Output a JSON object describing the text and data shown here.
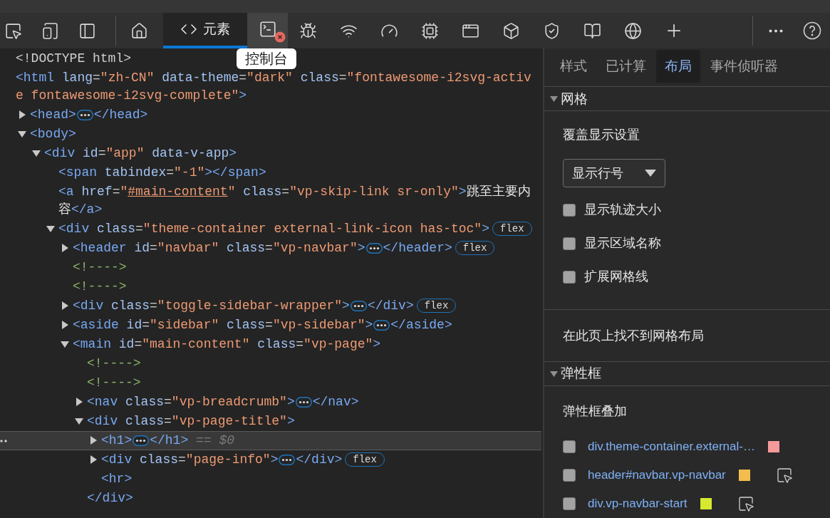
{
  "toolbar": {
    "tools": [
      {
        "kind": "inspect",
        "selected": false
      },
      {
        "kind": "device",
        "selected": false
      },
      {
        "kind": "dock",
        "selected": false
      },
      {
        "kind": "divider"
      },
      {
        "kind": "home",
        "selected": false
      },
      {
        "kind": "elements",
        "label": "元素",
        "selected": true
      },
      {
        "kind": "console",
        "selected": false,
        "hovered": true,
        "error": true,
        "tooltip": "控制台"
      },
      {
        "kind": "sources",
        "selected": false
      },
      {
        "kind": "network",
        "selected": false
      },
      {
        "kind": "performance",
        "selected": false
      },
      {
        "kind": "memory",
        "selected": false
      },
      {
        "kind": "application",
        "selected": false
      },
      {
        "kind": "cube",
        "selected": false
      },
      {
        "kind": "security",
        "selected": false
      },
      {
        "kind": "recorder",
        "selected": false
      },
      {
        "kind": "network-console",
        "selected": false
      },
      {
        "kind": "add",
        "selected": false
      },
      {
        "kind": "spacer"
      },
      {
        "kind": "divider"
      },
      {
        "kind": "more",
        "selected": false
      },
      {
        "kind": "help",
        "selected": false
      }
    ]
  },
  "dom": [
    {
      "tokens": [
        {
          "kind": "doctype",
          "text": "<!DOCTYPE html>"
        }
      ]
    },
    {
      "tokens": [
        {
          "kind": "tag",
          "text": "<html"
        },
        {
          "kind": "attr",
          "text": " lang"
        },
        {
          "kind": "eq",
          "text": "="
        },
        {
          "kind": "value",
          "text": "\"zh-CN\""
        },
        {
          "kind": "attr",
          "text": " data-theme"
        },
        {
          "kind": "eq",
          "text": "="
        },
        {
          "kind": "value",
          "text": "\"dark\""
        },
        {
          "kind": "attr",
          "text": " class"
        },
        {
          "kind": "eq",
          "text": "="
        },
        {
          "kind": "value",
          "text": "\"fontawesome-i2svg-active fontawesome-i2svg-complete\""
        },
        {
          "kind": "tag",
          "text": ">"
        }
      ],
      "children": [
        {
          "expanded": false,
          "tokens": [
            {
              "kind": "tag",
              "text": "<head>"
            },
            {
              "kind": "ellipsis"
            },
            {
              "kind": "tag",
              "text": "</head>"
            }
          ]
        },
        {
          "expanded": true,
          "tokens": [
            {
              "kind": "tag",
              "text": "<body>"
            }
          ],
          "children": [
            {
              "expanded": true,
              "tokens": [
                {
                  "kind": "tag",
                  "text": "<div"
                },
                {
                  "kind": "attr",
                  "text": " id"
                },
                {
                  "kind": "eq",
                  "text": "="
                },
                {
                  "kind": "value",
                  "text": "\"app\""
                },
                {
                  "kind": "attr",
                  "text": " data-v-app"
                },
                {
                  "kind": "tag",
                  "text": ">"
                }
              ],
              "children": [
                {
                  "tokens": [
                    {
                      "kind": "tag",
                      "text": "<span"
                    },
                    {
                      "kind": "attr",
                      "text": " tabindex"
                    },
                    {
                      "kind": "eq",
                      "text": "="
                    },
                    {
                      "kind": "value",
                      "text": "\"-1\""
                    },
                    {
                      "kind": "tag",
                      "text": "></span>"
                    }
                  ]
                },
                {
                  "tokens": [
                    {
                      "kind": "tag",
                      "text": "<a"
                    },
                    {
                      "kind": "attr",
                      "text": " href"
                    },
                    {
                      "kind": "eq",
                      "text": "="
                    },
                    {
                      "kind": "value",
                      "text": "\""
                    },
                    {
                      "kind": "link",
                      "text": "#main-content"
                    },
                    {
                      "kind": "value",
                      "text": "\""
                    },
                    {
                      "kind": "attr",
                      "text": " class"
                    },
                    {
                      "kind": "eq",
                      "text": "="
                    },
                    {
                      "kind": "value",
                      "text": "\"vp-skip-link sr-only\""
                    },
                    {
                      "kind": "tag",
                      "text": ">"
                    },
                    {
                      "kind": "text",
                      "text": "跳至主要内容"
                    },
                    {
                      "kind": "tag",
                      "text": "</a>"
                    }
                  ]
                },
                {
                  "expanded": true,
                  "tokens": [
                    {
                      "kind": "tag",
                      "text": "<div"
                    },
                    {
                      "kind": "attr",
                      "text": " class"
                    },
                    {
                      "kind": "eq",
                      "text": "="
                    },
                    {
                      "kind": "value",
                      "text": "\"theme-container external-link-icon has-toc\""
                    },
                    {
                      "kind": "tag",
                      "text": ">"
                    },
                    {
                      "kind": "badge",
                      "text": "flex"
                    }
                  ],
                  "children": [
                    {
                      "expanded": false,
                      "tokens": [
                        {
                          "kind": "tag",
                          "text": "<header"
                        },
                        {
                          "kind": "attr",
                          "text": " id"
                        },
                        {
                          "kind": "eq",
                          "text": "="
                        },
                        {
                          "kind": "value",
                          "text": "\"navbar\""
                        },
                        {
                          "kind": "attr",
                          "text": " class"
                        },
                        {
                          "kind": "eq",
                          "text": "="
                        },
                        {
                          "kind": "value",
                          "text": "\"vp-navbar\""
                        },
                        {
                          "kind": "tag",
                          "text": ">"
                        },
                        {
                          "kind": "ellipsis"
                        },
                        {
                          "kind": "tag",
                          "text": "</header>"
                        },
                        {
                          "kind": "badge",
                          "text": "flex"
                        }
                      ]
                    },
                    {
                      "tokens": [
                        {
                          "kind": "comment",
                          "text": "<!---->"
                        }
                      ]
                    },
                    {
                      "tokens": [
                        {
                          "kind": "comment",
                          "text": "<!---->"
                        }
                      ]
                    },
                    {
                      "expanded": false,
                      "tokens": [
                        {
                          "kind": "tag",
                          "text": "<div"
                        },
                        {
                          "kind": "attr",
                          "text": " class"
                        },
                        {
                          "kind": "eq",
                          "text": "="
                        },
                        {
                          "kind": "value",
                          "text": "\"toggle-sidebar-wrapper\""
                        },
                        {
                          "kind": "tag",
                          "text": ">"
                        },
                        {
                          "kind": "ellipsis"
                        },
                        {
                          "kind": "tag",
                          "text": "</div>"
                        },
                        {
                          "kind": "badge",
                          "text": "flex"
                        }
                      ]
                    },
                    {
                      "expanded": false,
                      "tokens": [
                        {
                          "kind": "tag",
                          "text": "<aside"
                        },
                        {
                          "kind": "attr",
                          "text": " id"
                        },
                        {
                          "kind": "eq",
                          "text": "="
                        },
                        {
                          "kind": "value",
                          "text": "\"sidebar\""
                        },
                        {
                          "kind": "attr",
                          "text": " class"
                        },
                        {
                          "kind": "eq",
                          "text": "="
                        },
                        {
                          "kind": "value",
                          "text": "\"vp-sidebar\""
                        },
                        {
                          "kind": "tag",
                          "text": ">"
                        },
                        {
                          "kind": "ellipsis"
                        },
                        {
                          "kind": "tag",
                          "text": "</aside>"
                        }
                      ]
                    },
                    {
                      "expanded": true,
                      "tokens": [
                        {
                          "kind": "tag",
                          "text": "<main"
                        },
                        {
                          "kind": "attr",
                          "text": " id"
                        },
                        {
                          "kind": "eq",
                          "text": "="
                        },
                        {
                          "kind": "value",
                          "text": "\"main-content\""
                        },
                        {
                          "kind": "attr",
                          "text": " class"
                        },
                        {
                          "kind": "eq",
                          "text": "="
                        },
                        {
                          "kind": "value",
                          "text": "\"vp-page\""
                        },
                        {
                          "kind": "tag",
                          "text": ">"
                        }
                      ],
                      "children": [
                        {
                          "tokens": [
                            {
                              "kind": "comment",
                              "text": "<!---->"
                            }
                          ]
                        },
                        {
                          "tokens": [
                            {
                              "kind": "comment",
                              "text": "<!---->"
                            }
                          ]
                        },
                        {
                          "expanded": false,
                          "tokens": [
                            {
                              "kind": "tag",
                              "text": "<nav"
                            },
                            {
                              "kind": "attr",
                              "text": " class"
                            },
                            {
                              "kind": "eq",
                              "text": "="
                            },
                            {
                              "kind": "value",
                              "text": "\"vp-breadcrumb\""
                            },
                            {
                              "kind": "tag",
                              "text": ">"
                            },
                            {
                              "kind": "ellipsis"
                            },
                            {
                              "kind": "tag",
                              "text": "</nav>"
                            }
                          ]
                        },
                        {
                          "expanded": true,
                          "tokens": [
                            {
                              "kind": "tag",
                              "text": "<div"
                            },
                            {
                              "kind": "attr",
                              "text": " class"
                            },
                            {
                              "kind": "eq",
                              "text": "="
                            },
                            {
                              "kind": "value",
                              "text": "\"vp-page-title\""
                            },
                            {
                              "kind": "tag",
                              "text": ">"
                            }
                          ],
                          "close": [
                            {
                              "kind": "tag",
                              "text": "</div>"
                            }
                          ],
                          "children": [
                            {
                              "expanded": false,
                              "selected": true,
                              "tokens": [
                                {
                                  "kind": "tag",
                                  "text": "<h1>"
                                },
                                {
                                  "kind": "ellipsis"
                                },
                                {
                                  "kind": "tag",
                                  "text": "</h1>"
                                },
                                {
                                  "kind": "ref",
                                  "text": " == $0"
                                }
                              ]
                            },
                            {
                              "expanded": false,
                              "selected": false,
                              "tokens": [
                                {
                                  "kind": "tag",
                                  "text": "<div"
                                },
                                {
                                  "kind": "attr",
                                  "text": " class"
                                },
                                {
                                  "kind": "eq",
                                  "text": "="
                                },
                                {
                                  "kind": "value",
                                  "text": "\"page-info\""
                                },
                                {
                                  "kind": "tag",
                                  "text": ">"
                                },
                                {
                                  "kind": "ellipsis"
                                },
                                {
                                  "kind": "tag",
                                  "text": "</div>"
                                },
                                {
                                  "kind": "badge",
                                  "text": "flex"
                                }
                              ]
                            },
                            {
                              "tokens": [
                                {
                                  "kind": "tag",
                                  "text": "<hr>"
                                }
                              ]
                            }
                          ]
                        }
                      ]
                    }
                  ]
                }
              ]
            }
          ]
        }
      ]
    }
  ],
  "styles_tabs": [
    {
      "label": "样式",
      "selected": false
    },
    {
      "label": "已计算",
      "selected": false
    },
    {
      "label": "布局",
      "selected": true
    },
    {
      "label": "事件侦听器",
      "selected": false
    }
  ],
  "grid": {
    "title": "网格",
    "expanded": true,
    "overlay_title": "覆盖显示设置",
    "dropdown": "显示行号",
    "checkboxes": [
      {
        "label": "显示轨迹大小",
        "checked": false
      },
      {
        "label": "显示区域名称",
        "checked": false
      },
      {
        "label": "扩展网格线",
        "checked": false
      }
    ],
    "message": "在此页上找不到网格布局"
  },
  "flexbox": {
    "title": "弹性框",
    "expanded": true,
    "overlay_title": "弹性框叠加",
    "items": [
      {
        "label": "div.theme-container.external-…",
        "color": "#f49a9a",
        "checked": false,
        "show_inspect": false
      },
      {
        "label": "header#navbar.vp-navbar",
        "color": "#f2bd4c",
        "checked": false,
        "show_inspect": true
      },
      {
        "label": "div.vp-navbar-start",
        "color": "#d5e92f",
        "checked": false,
        "show_inspect": true
      }
    ]
  }
}
